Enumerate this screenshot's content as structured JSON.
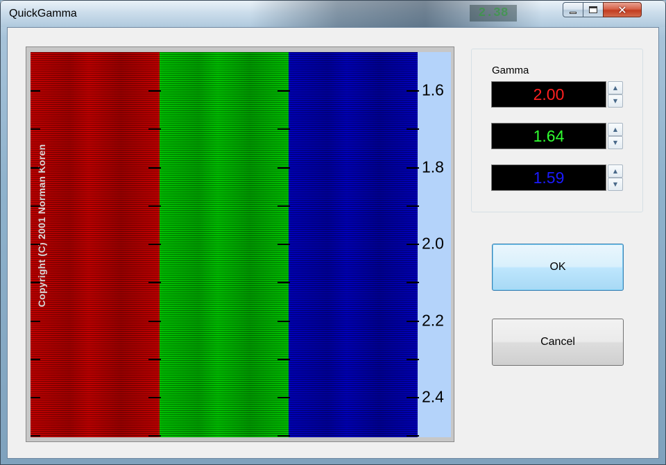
{
  "window": {
    "title": "QuickGamma",
    "background_readout": "2.38",
    "controls": {
      "minimize_icon": "minimize-icon",
      "maximize_icon": "maximize-icon",
      "close_icon": "close-icon"
    }
  },
  "chart": {
    "copyright": "Copyright (C) 2001   Norman Koren",
    "bands": [
      {
        "name": "red",
        "color": "#c00000"
      },
      {
        "name": "green",
        "color": "#00c000"
      },
      {
        "name": "blue",
        "color": "#0000b8"
      }
    ],
    "scale_labels": [
      "1.6",
      "1.8",
      "2.0",
      "2.2",
      "2.4"
    ],
    "scale_background": "#b4d3fa"
  },
  "gamma": {
    "label": "Gamma",
    "values": [
      {
        "value": "2.00",
        "color": "#ff2020"
      },
      {
        "value": "1.64",
        "color": "#30ff30"
      },
      {
        "value": "1.59",
        "color": "#1a1aff"
      }
    ],
    "spin_up_glyph": "▲",
    "spin_down_glyph": "▼"
  },
  "buttons": {
    "ok_label": "OK",
    "cancel_label": "Cancel"
  }
}
